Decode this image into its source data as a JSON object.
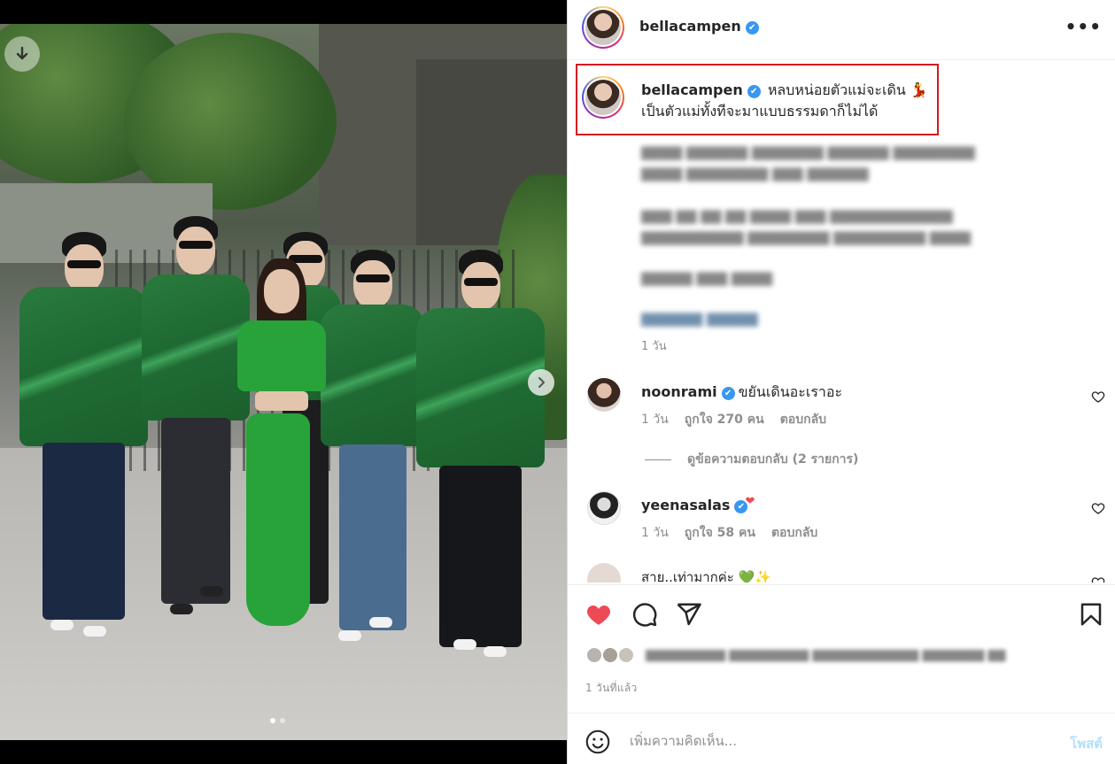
{
  "post": {
    "author": "bellacampen",
    "verified_mark": "✔",
    "more_label": "•••",
    "caption_line1": "หลบหน่อยตัวแม่จะเดิน 💃",
    "caption_line2": "เป็นตัวแม่ทั้งทีจะมาแบบธรรมดาก็ไม่ได้",
    "caption_time": "1 วัน"
  },
  "comments": [
    {
      "user": "noonrami",
      "text": "ขยันเดินอะเราอะ",
      "time": "1 วัน",
      "likes": "ถูกใจ 270 คน",
      "reply": "ตอบกลับ",
      "view_replies": "ดูข้อความตอบกลับ (2 รายการ)"
    },
    {
      "user": "yeenasalas",
      "badge": "❤",
      "text": "",
      "time": "1 วัน",
      "likes": "ถูกใจ 58 คน",
      "reply": "ตอบกลับ"
    },
    {
      "user": "",
      "text": "สาย..เท่ามากค่ะ 💚✨"
    }
  ],
  "footer": {
    "post_time": "1 วันที่แล้ว",
    "comment_placeholder": "เพิ่มความคิดเห็น...",
    "post_button": "โพสต์",
    "liked": true
  },
  "media": {
    "slide_count": 2,
    "current_slide": 1
  },
  "icons": {
    "download": "download-icon",
    "next": "chevron-right-icon",
    "like": "heart-icon",
    "comment": "comment-icon",
    "share": "share-icon",
    "save": "bookmark-icon",
    "emoji": "emoji-icon"
  },
  "colors": {
    "like_red": "#ed4956",
    "verified_blue": "#3897f0",
    "highlight_border": "#d71920",
    "post_button_disabled": "#b2dffc"
  }
}
